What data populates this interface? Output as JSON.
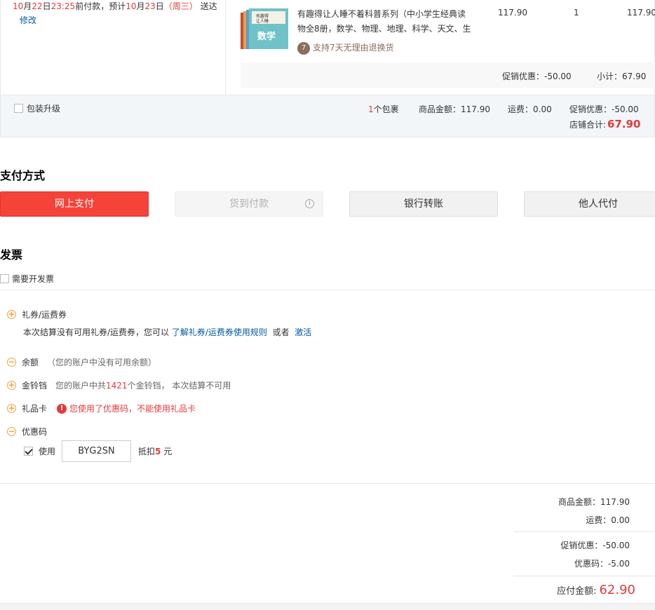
{
  "delivery": {
    "date_month": "10",
    "date_month_unit": "月",
    "date_day": "22",
    "date_day_unit": "日",
    "time": "23:25",
    "prefix_text": "前付款，预计",
    "eta_month": "10",
    "eta_month_unit": "月",
    "eta_day": "23",
    "eta_day_unit": "日",
    "eta_weekday_open": "（",
    "eta_weekday": "周三",
    "eta_weekday_close": "）",
    "suffix_text": "送达",
    "modify_label": "修改"
  },
  "product": {
    "thumb_text": "数学",
    "title": "有趣得让人睡不着科普系列（中小学生经典读物全8册，数学、物理、地理、科学、天文、生",
    "return_badge_num": "7",
    "return_badge_text": "支持7天无理由退换货",
    "unit_price": "117.90",
    "quantity": "1",
    "line_total": "117.90",
    "promo_discount": "促销优惠：-50.00",
    "subtotal": "小计：67.90"
  },
  "summary": {
    "pack_upgrade_label": "包装升级",
    "package_count_num": "1",
    "package_count_text": "个包裹",
    "goods_amount": "商品金额：117.90",
    "shipping_fee": "运费：0.00",
    "promo_amount": "促销优惠：-50.00",
    "store_total_label": "店铺合计:",
    "store_total_value": "67.90"
  },
  "payment": {
    "title": "支付方式",
    "online": "网上支付",
    "cod": "货到付款",
    "cod_info_icon": "i",
    "bank": "银行转账",
    "other": "他人代付"
  },
  "invoice": {
    "title": "发票",
    "need_invoice_label": "需要开发票"
  },
  "benefits": {
    "coupon_name": "礼券/运费券",
    "coupon_desc_prefix": "本次结算没有可用礼券/运费券，您可以",
    "coupon_rules_link": "了解礼券/运费券使用规则",
    "coupon_or": "或者",
    "coupon_activate_link": "激活",
    "balance_name": "余额",
    "balance_desc": "（您的账户中没有可用余额）",
    "jindou_name": "金铃铛",
    "jindou_desc_prefix": "您的账户中共",
    "jindou_count": "1421",
    "jindou_desc_suffix": "个金铃铛， 本次结算不可用",
    "giftcard_name": "礼品卡",
    "giftcard_warning_icon": "!",
    "giftcard_warning": "您使用了优惠码，不能使用礼品卡",
    "promo_code_name": "优惠码",
    "use_label": "使用",
    "code_value": "BYG2SN",
    "deduct_prefix": "抵扣",
    "deduct_amount": "5",
    "deduct_unit": "元"
  },
  "totals": {
    "goods": "商品金额：117.90",
    "shipping": "运费：0.00",
    "promo": "促销优惠：-50.00",
    "code": "优惠码：-5.00",
    "payable_label": "应付金额:",
    "payable_value": "62.90"
  },
  "colors": {
    "accent_red": "#e4393c",
    "link_blue": "#005aa0",
    "pay_button": "#f5433a",
    "expand_icon": "#f0a340"
  }
}
